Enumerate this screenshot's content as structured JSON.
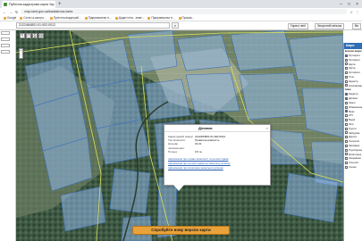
{
  "browser": {
    "tab_title": "Публічна кадастрова карта Укр",
    "url": "map.land.gov.ua/kadastrova-karta",
    "bookmarks": [
      "Google",
      "Сстаті а-кастро...",
      "Пулістна віадстрай...",
      "Підприємства ті...",
      "Додаті ліга - земе...",
      "Підприємства ті...",
      "Прошіа..."
    ]
  },
  "app": {
    "search_value": "2122484801:01:002:0012",
    "search_icon": "search-icon",
    "header_btn_1": "Гарячі лінії",
    "header_btn_2": "Зворотній зв'язок",
    "header_btn_3": "Ви"
  },
  "popup": {
    "title": "Ділянка",
    "close": "×",
    "rows": [
      {
        "k": "Кадастровий номер:",
        "v": "2122484801:01:002:0012"
      },
      {
        "k": "Тип власності:",
        "v": "Приватна власність"
      },
      {
        "k": "Цільове призначення:",
        "v": "01.01"
      },
      {
        "k": "Площа:",
        "v": "0.5 га"
      }
    ],
    "links": [
      "Інформація про право власності та речові права",
      "Інформація про речові права на земельну ділянку",
      "Інформація про власника земельної ділянки"
    ]
  },
  "bottom_button": "Спробуйте нову версію карти",
  "layers": {
    "header": "Шари",
    "section_base": "Базові шари",
    "base_items": [
      "Ортофото",
      "Ортофото",
      "Карта",
      "Карта",
      "Ортофото",
      "Топо",
      "Кадастр",
      "Класифікація"
    ],
    "section_other": "Інше",
    "other_items": [
      "Кадастр",
      "Ділянки",
      "Землі",
      "Обмеження",
      "Межі",
      "АТУ",
      "Водні",
      "Ліси",
      "Ґрунти",
      "Забудова",
      "Дороги",
      "Охоронні",
      "Заповідні",
      "Тероборона",
      "Моніторинг",
      "Зонування",
      "Сільгосп",
      "Схеми"
    ]
  },
  "colors": {
    "parcel_fill": "#8fb6e8",
    "parcel_stroke": "#3b6fb8",
    "boundary": "#d9e05a",
    "button": "#e9a23b",
    "layer_header": "#2f6db5"
  }
}
